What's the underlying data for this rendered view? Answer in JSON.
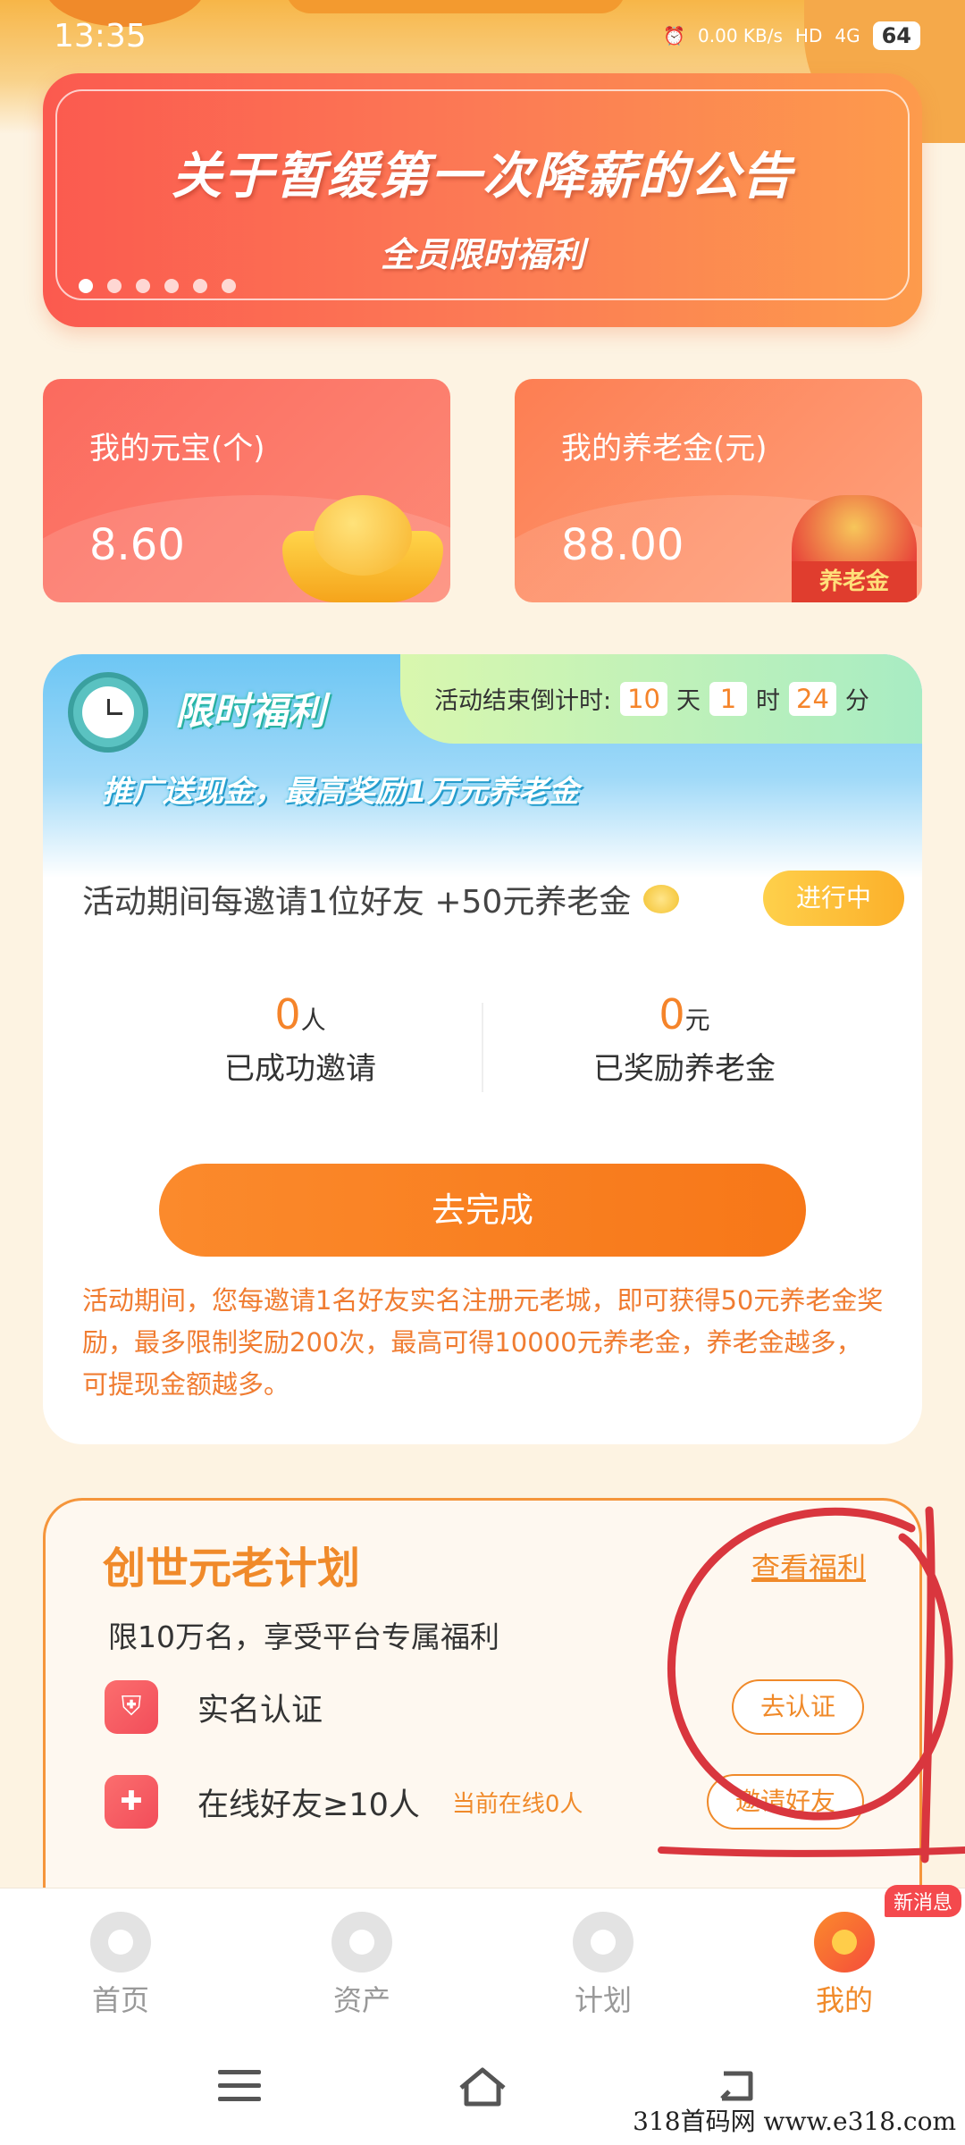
{
  "status_bar": {
    "time": "13:35",
    "net_speed": "0.00 KB/s",
    "hd": "HD",
    "signal": "4G",
    "battery": "64"
  },
  "banner": {
    "title": "关于暂缓第一次降薪的公告",
    "subtitle": "全员限时福利",
    "dots": 6,
    "active_dot": 0
  },
  "balances": {
    "ingot_label": "我的元宝(个)",
    "ingot_value": "8.60",
    "pension_label": "我的养老金(元)",
    "pension_value": "88.00",
    "pension_tag": "养老金"
  },
  "promo": {
    "title": "限时福利",
    "countdown_label": "活动结束倒计时:",
    "days": "10",
    "days_unit": "天",
    "hours": "1",
    "hours_unit": "时",
    "minutes": "24",
    "minutes_unit": "分",
    "slogan": "推广送现金，最高奖励1万元养老金",
    "rule": "活动期间每邀请1位好友 +50元养老金",
    "status": "进行中",
    "invited_count": "0",
    "invited_unit": "人",
    "invited_label": "已成功邀请",
    "reward_amount": "0",
    "reward_unit": "元",
    "reward_label": "已奖励养老金",
    "button": "去完成",
    "description": "活动期间，您每邀请1名好友实名注册元老城，即可获得50元养老金奖励，最多限制奖励200次，最高可得10000元养老金，养老金越多，可提现金额越多。"
  },
  "plan": {
    "title": "创世元老计划",
    "link": "查看福利",
    "subtitle": "限10万名，享受平台专属福利",
    "rows": [
      {
        "label": "实名认证",
        "hint": "",
        "button": "去认证"
      },
      {
        "label": "在线好友≥10人",
        "hint": "当前在线0人",
        "button": "邀请好友"
      }
    ]
  },
  "tabbar": {
    "tabs": [
      {
        "label": "首页"
      },
      {
        "label": "资产"
      },
      {
        "label": "计划"
      },
      {
        "label": "我的"
      }
    ],
    "active_index": 3,
    "badge": "新消息"
  },
  "watermark": "318首码网   www.e318.com",
  "colors": {
    "accent": "#f08a2a",
    "banner_start": "#fb5a4f",
    "banner_end": "#fd9b4c",
    "button": "#f77718",
    "annotation": "#d9363e"
  }
}
